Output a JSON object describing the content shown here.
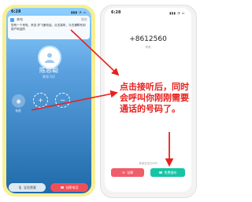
{
  "left_phone": {
    "status_time": "6:28",
    "status_icons": "▮▮▮ ◔ ▭",
    "notification": {
      "app": "来电",
      "time": "现在",
      "text": "您有一个来电，来自 好飞速电话。点击接听，与去通联系到用户电话的"
    },
    "caller": {
      "name": "陈思聪",
      "sub": "陈思 5/2"
    },
    "buttons": {
      "speaker": "免提",
      "mute_label": "全员禁麦",
      "hangup_label": "挂断电话"
    }
  },
  "right_phone": {
    "status_time": "6:28",
    "status_icons": "▮▮▮ ◔ ▭",
    "phone_number": "+8612560",
    "sub": "来电",
    "footer": "来电无法已APP",
    "reject_label": "挂断",
    "accept_label": "免费接听"
  },
  "annotation": {
    "text": "点击接听后，同时会呼叫你刚刚需要通话的号码了。",
    "color": "#e8211e"
  },
  "colors": {
    "left_frame": "#f7ef95",
    "hangup_red": "#f04f5a",
    "accept_green": "#16c4a6",
    "reject_red": "#ef5d6a"
  }
}
